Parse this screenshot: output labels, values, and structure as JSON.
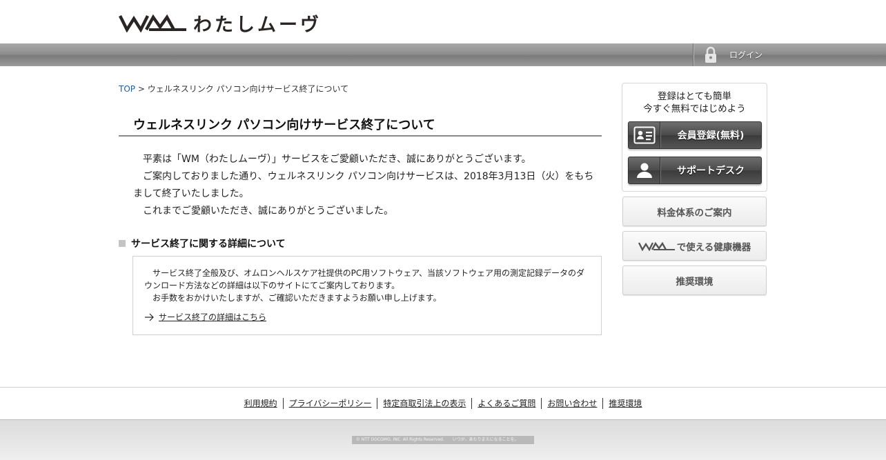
{
  "header": {
    "logo_text": "わたしムーヴ",
    "login_label": "ログイン"
  },
  "breadcrumb": {
    "top_label": "TOP",
    "separator": " > ",
    "current": "ウェルネスリンク パソコン向けサービス終了について"
  },
  "main": {
    "title": "ウェルネスリンク パソコン向けサービス終了について",
    "intro": [
      "平素は「WM（わたしムーヴ）」サービスをご愛顧いただき、誠にありがとうございます。",
      "ご案内しておりました通り、ウェルネスリンク パソコン向けサービスは、2018年3月13日（火）をもちまして終了いたしました。",
      "これまでご愛顧いただき、誠にありがとうございました。"
    ],
    "section_heading": "サービス終了に関する詳細について",
    "detail": {
      "text1": "サービス終了全般及び、オムロンヘルスケア社提供のPC用ソフトウェア、当該ソフトウェア用の測定記録データのダウンロード方法などの詳細は以下のサイトにてご案内しております。",
      "text2": "お手数をおかけいたしますが、ご確認いただきますようお願い申し上げます。",
      "link": "サービス終了の詳細はこちら"
    }
  },
  "sidebar": {
    "caption_line1": "登録はとても簡単",
    "caption_line2": "今すぐ無料ではじめよう",
    "register_label": "会員登録(無料)",
    "support_label": "サポートデスク",
    "pricing_label": "料金体系のご案内",
    "devices_label": "で使える健康機器",
    "env_label": "推奨環境"
  },
  "footer": {
    "links": [
      "利用規約",
      "プライバシーポリシー",
      "特定商取引法上の表示",
      "よくあるご質問",
      "お問い合わせ",
      "推奨環境"
    ],
    "copyright": "© NTT DOCOMO, INC. All Rights Reserved.　　いつか、あたりまえになることを。"
  },
  "colors": {
    "link_blue": "#1f5f9a",
    "navbar_gray": "#8e8e8e",
    "dark_button": "#4a4a4a"
  }
}
